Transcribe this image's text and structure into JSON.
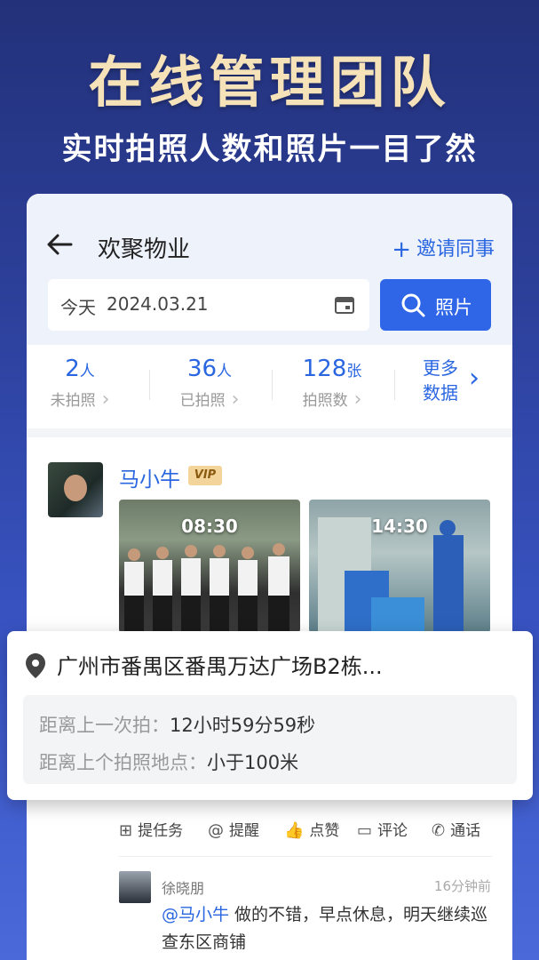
{
  "hero": {
    "title": "在线管理团队",
    "subtitle": "实时拍照人数和照片一目了然"
  },
  "header": {
    "company": "欢聚物业",
    "invite": "邀请同事",
    "invite_icon": "plus-icon",
    "date_label": "今天",
    "date": "2024.03.21",
    "photo_btn": "照片"
  },
  "stats": [
    {
      "num": "2",
      "unit": "人",
      "label": "未拍照"
    },
    {
      "num": "36",
      "unit": "人",
      "label": "已拍照"
    },
    {
      "num": "128",
      "unit": "张",
      "label": "拍照数"
    }
  ],
  "more": {
    "line1": "更多",
    "line2": "数据"
  },
  "post": {
    "user": "马小牛",
    "badge": "VIP",
    "photos": [
      {
        "time": "08:30"
      },
      {
        "time": "14:30"
      }
    ]
  },
  "location": {
    "address": "广州市番禺区番禺万达广场B2栋...",
    "last_shot_label": "距离上一次拍：",
    "last_shot_value": "12小时59分59秒",
    "last_place_label": "距离上个拍照地点：",
    "last_place_value": "小于100米"
  },
  "actions": [
    "提任务",
    "提醒",
    "点赞",
    "评论",
    "通话"
  ],
  "comment": {
    "user": "徐晓朋",
    "time": "16分钟前",
    "mention": "@马小牛",
    "text": " 做的不错，早点休息，明天继续巡查东区商铺"
  },
  "colors": {
    "accent": "#2f66e8",
    "bg": "#2c3f99",
    "gold": "#f6e2b8"
  }
}
